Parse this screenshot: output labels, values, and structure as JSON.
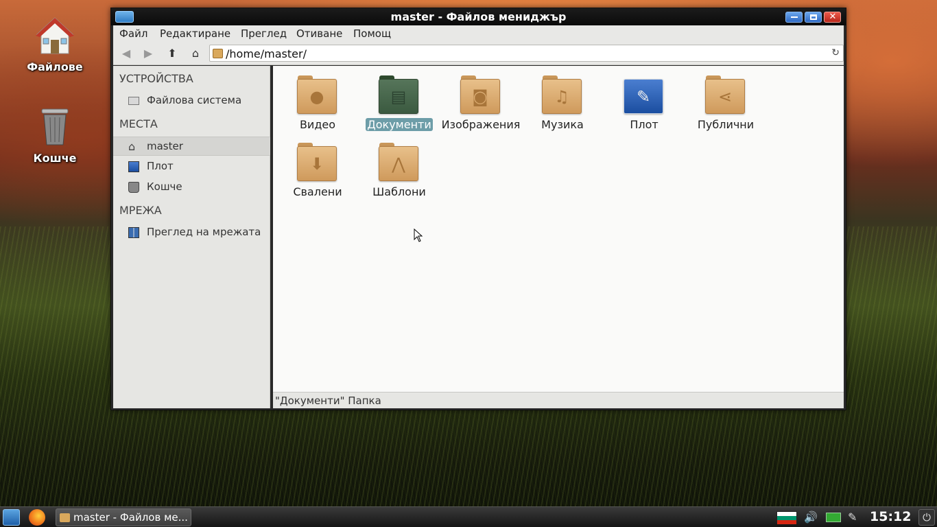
{
  "desktop": {
    "icons": [
      {
        "label": "Файлове"
      },
      {
        "label": "Кошче"
      }
    ]
  },
  "window": {
    "title": "master - Файлов мениджър",
    "menu": [
      "Файл",
      "Редактиране",
      "Преглед",
      "Отиване",
      "Помощ"
    ],
    "toolbar": {
      "path": "/home/master/"
    },
    "sidebar": {
      "sections": [
        {
          "header": "УСТРОЙСТВА",
          "items": [
            "Файлова система"
          ]
        },
        {
          "header": "МЕСТА",
          "items": [
            "master",
            "Плот",
            "Кошче"
          ]
        },
        {
          "header": "МРЕЖА",
          "items": [
            "Преглед на мрежата"
          ]
        }
      ]
    },
    "files": [
      {
        "name": "Видео",
        "icon": "video-folder-icon"
      },
      {
        "name": "Документи",
        "icon": "documents-folder-icon",
        "selected": true
      },
      {
        "name": "Изображения",
        "icon": "pictures-folder-icon"
      },
      {
        "name": "Музика",
        "icon": "music-folder-icon"
      },
      {
        "name": "Плот",
        "icon": "desktop-folder-icon"
      },
      {
        "name": "Публични",
        "icon": "public-folder-icon"
      },
      {
        "name": "Свалени",
        "icon": "downloads-folder-icon"
      },
      {
        "name": "Шаблони",
        "icon": "templates-folder-icon"
      }
    ],
    "status": "\"Документи\" Папка"
  },
  "taskbar": {
    "task_title": "master - Файлов ме...",
    "clock": "15:12"
  },
  "colors": {
    "selection": "#6d9da8",
    "folder": "#d9a85c",
    "titlebar": "#0a0a0a"
  }
}
